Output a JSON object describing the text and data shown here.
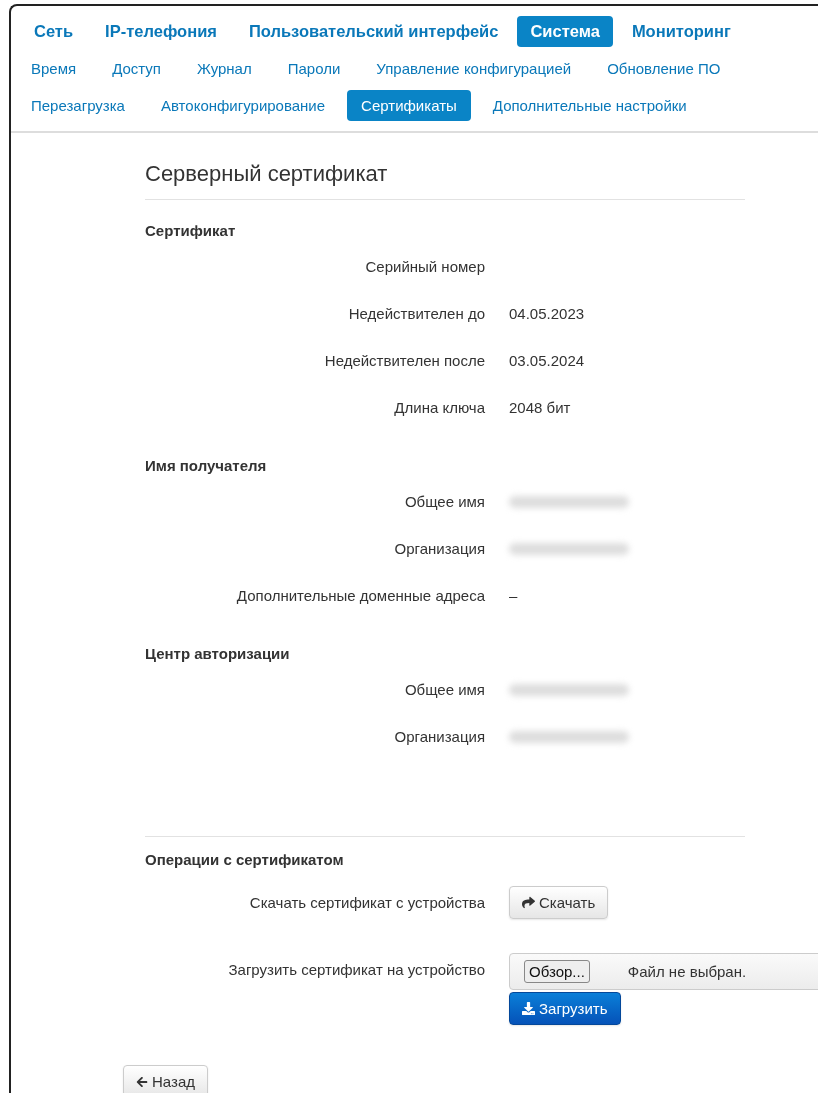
{
  "main_nav": [
    {
      "label": "Сеть",
      "selected": false
    },
    {
      "label": "IP-телефония",
      "selected": false
    },
    {
      "label": "Пользовательский интерфейс",
      "selected": false
    },
    {
      "label": "Система",
      "selected": true
    },
    {
      "label": "Мониторинг",
      "selected": false
    }
  ],
  "sub_nav": [
    {
      "items": [
        {
          "label": "Время",
          "selected": false
        },
        {
          "label": "Доступ",
          "selected": false
        },
        {
          "label": "Журнал",
          "selected": false
        },
        {
          "label": "Пароли",
          "selected": false
        },
        {
          "label": "Управление конфигурацией",
          "selected": false
        },
        {
          "label": "Обновление ПО",
          "selected": false
        }
      ]
    },
    {
      "items": [
        {
          "label": "Перезагрузка",
          "selected": false
        },
        {
          "label": "Автоконфигурирование",
          "selected": false
        },
        {
          "label": "Сертификаты",
          "selected": true
        },
        {
          "label": "Дополнительные настройки",
          "selected": false
        }
      ]
    }
  ],
  "title": "Серверный сертификат",
  "sections": [
    {
      "heading": "Сертификат",
      "fields": [
        {
          "label": "Серийный номер"
        },
        {
          "label": "Недействителен до",
          "value": "04.05.2023"
        },
        {
          "label": "Недействителен после",
          "value": "03.05.2024"
        },
        {
          "label": "Длина ключа",
          "value": "2048 бит"
        }
      ]
    },
    {
      "heading": "Имя получателя",
      "fields": [
        {
          "label": "Общее имя",
          "blurred": true
        },
        {
          "label": "Организация",
          "blurred": true
        },
        {
          "label": "Дополнительные доменные адреса",
          "value": "–"
        }
      ]
    },
    {
      "heading": "Центр авторизации",
      "fields": [
        {
          "label": "Общее имя",
          "blurred": true
        },
        {
          "label": "Организация",
          "blurred": true
        }
      ]
    }
  ],
  "operations": {
    "heading": "Операции с сертификатом",
    "download": {
      "label": "Скачать сертификат с устройства",
      "button": "Скачать"
    },
    "upload": {
      "label": "Загрузить сертификат на устройство",
      "browse_button": "Обзор...",
      "file_status": "Файл не выбран.",
      "button": "Загрузить"
    }
  },
  "back_button": "Назад"
}
